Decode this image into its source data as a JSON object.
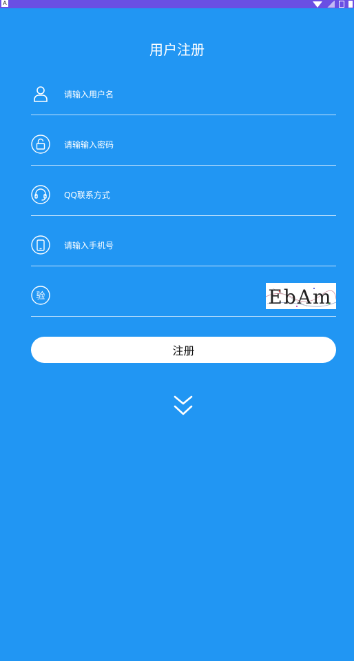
{
  "status_bar": {
    "left_badge": "A"
  },
  "page": {
    "title": "用户注册"
  },
  "form": {
    "username": {
      "placeholder": "请输入用户名",
      "icon": "user-icon"
    },
    "password": {
      "placeholder": "请输输入密码",
      "icon": "unlock-icon"
    },
    "qq": {
      "placeholder": "QQ联系方式",
      "icon": "headset-icon"
    },
    "phone": {
      "placeholder": "请输入手机号",
      "icon": "phone-icon"
    },
    "captcha": {
      "icon_label": "验",
      "image_text": "EbAm"
    }
  },
  "register_button": {
    "label": "注册"
  },
  "colors": {
    "background": "#2196F3",
    "statusbar": "#6A4FE3",
    "button": "#FFFFFF"
  },
  "footer": {
    "icon": "double-chevron-down-icon"
  }
}
